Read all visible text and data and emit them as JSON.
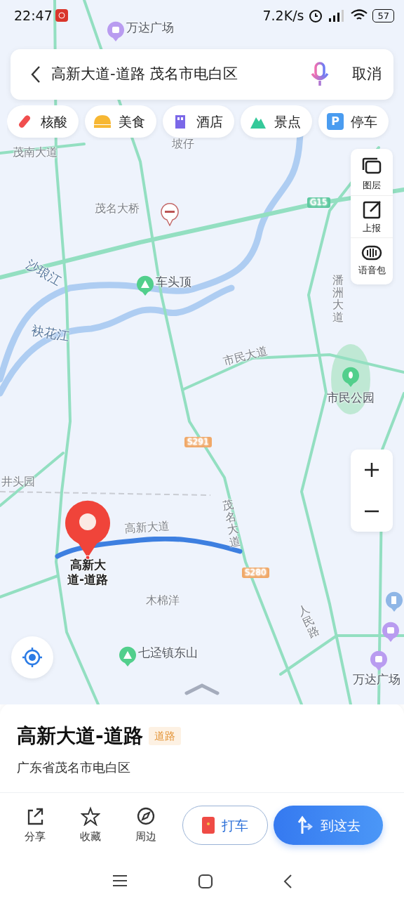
{
  "status_bar": {
    "time": "22:47",
    "net_speed": "7.2K/s",
    "battery": "57"
  },
  "search": {
    "query": "高新大道-道路 茂名市电白区",
    "cancel": "取消"
  },
  "categories": [
    {
      "label": "核酸",
      "kind": "test"
    },
    {
      "label": "美食",
      "kind": "food"
    },
    {
      "label": "酒店",
      "kind": "hotel"
    },
    {
      "label": "景点",
      "kind": "scenic"
    },
    {
      "label": "停车",
      "kind": "parking",
      "badge": "P"
    }
  ],
  "map": {
    "labels": [
      {
        "text": "万达广场",
        "kind": "shop"
      },
      {
        "text": "坡仔",
        "kind": "area"
      },
      {
        "text": "茂南大道",
        "kind": "road"
      },
      {
        "text": "茂名大桥",
        "kind": "area"
      },
      {
        "text": "G15",
        "kind": "shield-green"
      },
      {
        "text": "车头顶",
        "kind": "mountain"
      },
      {
        "text": "沙琅江",
        "kind": "water"
      },
      {
        "text": "袂花江",
        "kind": "water"
      },
      {
        "text": "潘洲大道",
        "kind": "road"
      },
      {
        "text": "市民大道",
        "kind": "road"
      },
      {
        "text": "市民公园",
        "kind": "park"
      },
      {
        "text": "S291",
        "kind": "shield-orange"
      },
      {
        "text": "井头园",
        "kind": "area"
      },
      {
        "text": "茂名大道",
        "kind": "road"
      },
      {
        "text": "高新大道",
        "kind": "road"
      },
      {
        "text": "S280",
        "kind": "shield-orange"
      },
      {
        "text": "木棉洋",
        "kind": "area"
      },
      {
        "text": "人民路",
        "kind": "road"
      },
      {
        "text": "七迳镇东山",
        "kind": "mountain"
      },
      {
        "text": "万达广场",
        "kind": "shop"
      }
    ],
    "marker_label": "高新大道-道路"
  },
  "map_tools": [
    {
      "label": "图层",
      "kind": "layers"
    },
    {
      "label": "上报",
      "kind": "report"
    },
    {
      "label": "语音包",
      "kind": "voice"
    }
  ],
  "place": {
    "title": "高新大道-道路",
    "tag": "道路",
    "address": "广东省茂名市电白区"
  },
  "actions": [
    {
      "label": "分享",
      "kind": "share"
    },
    {
      "label": "收藏",
      "kind": "favorite"
    },
    {
      "label": "周边",
      "kind": "nearby"
    }
  ],
  "buttons": [
    {
      "label": "打车",
      "kind": "taxi"
    },
    {
      "label": "到这去",
      "kind": "route"
    }
  ]
}
